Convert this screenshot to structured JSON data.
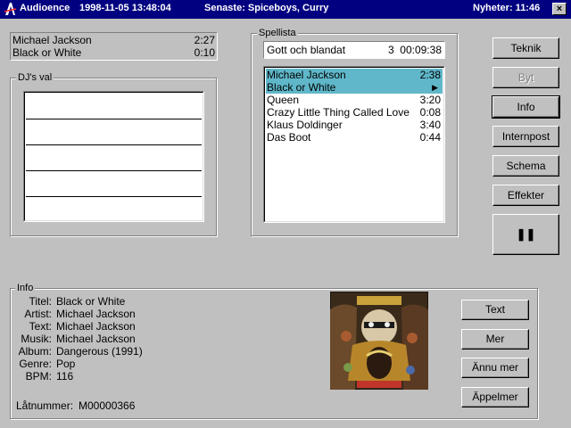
{
  "window": {
    "app_name": "Audioence",
    "datetime": "1998-11-05 13:48:04",
    "latest": "Senaste: Spiceboys, Curry",
    "news": "Nyheter: 11:46",
    "close_glyph": "×"
  },
  "now_playing": [
    {
      "title": "Michael Jackson",
      "time": "2:27"
    },
    {
      "title": "Black or White",
      "time": "0:10"
    }
  ],
  "dj": {
    "label": "DJ's val"
  },
  "playlist": {
    "label": "Spellista",
    "selector": {
      "name": "Gott och blandat",
      "count": "3",
      "duration": "00:09:38"
    },
    "items": [
      {
        "title": "Michael Jackson",
        "time": "2:38",
        "selected": true
      },
      {
        "title": "Black or White",
        "time": "▶",
        "selected": true
      },
      {
        "title": "Queen",
        "time": "3:20"
      },
      {
        "title": "Crazy Little Thing Called Love",
        "time": "0:08"
      },
      {
        "title": "Klaus Doldinger",
        "time": "3:40"
      },
      {
        "title": "Das Boot",
        "time": "0:44"
      }
    ]
  },
  "side_buttons": {
    "teknik": "Teknik",
    "byt": "Byt",
    "info": "Info",
    "internpost": "Internpost",
    "schema": "Schema",
    "effekter": "Effekter",
    "pause": "❚❚"
  },
  "info": {
    "label": "Info",
    "fields": [
      {
        "key": "Titel:",
        "value": "Black or White"
      },
      {
        "key": "Artist:",
        "value": "Michael Jackson"
      },
      {
        "key": "Text:",
        "value": "Michael Jackson"
      },
      {
        "key": "Musik:",
        "value": "Michael Jackson"
      },
      {
        "key": "Album:",
        "value": "Dangerous (1991)"
      },
      {
        "key": "Genre:",
        "value": "Pop"
      },
      {
        "key": "BPM:",
        "value": "116"
      }
    ],
    "track_number_label": "Låtnummer:",
    "track_number": "M00000366",
    "buttons": {
      "text": "Text",
      "mer": "Mer",
      "annu_mer": "Ännu mer",
      "appelmer": "Äppelmer"
    }
  },
  "colors": {
    "titlebar": "#000080",
    "selection": "#5fb7c9",
    "face": "#c0c0c0"
  }
}
